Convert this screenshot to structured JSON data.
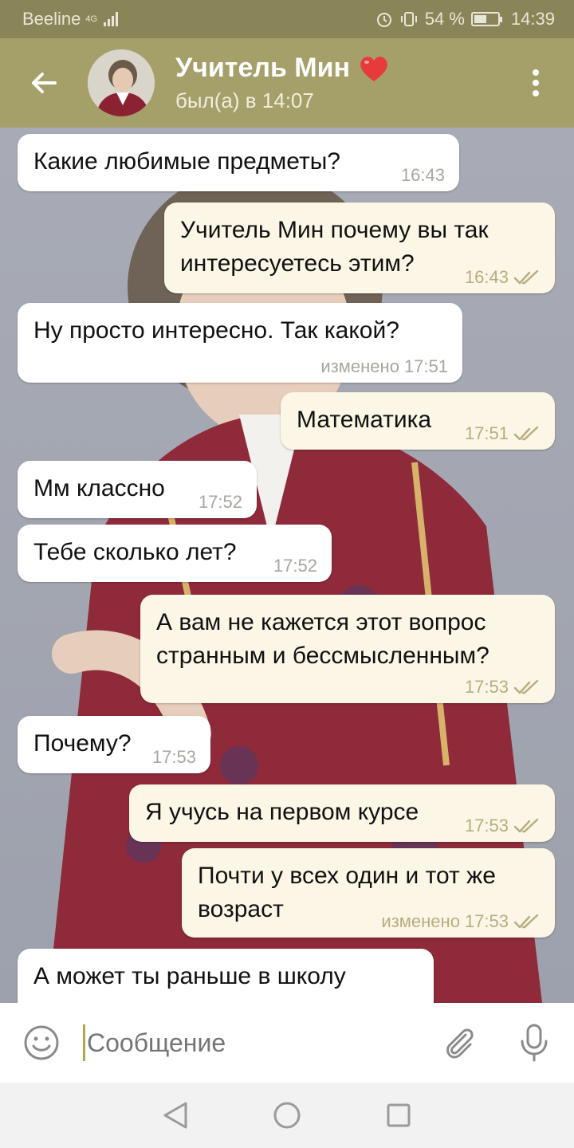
{
  "status_bar": {
    "carrier": "Beeline",
    "network": "4G",
    "battery": "54 %",
    "battery_level": 0.54,
    "time": "14:39"
  },
  "header": {
    "title": "Учитель Мин",
    "emoji": "❤️",
    "subtitle": "был(а) в 14:07",
    "back_icon": "arrow-left-icon",
    "menu_icon": "more-vert-icon"
  },
  "messages": [
    {
      "dir": "in",
      "text": "Какие любимые предметы?",
      "time": "16:43",
      "edited": ""
    },
    {
      "dir": "out",
      "text": "Учитель Мин почему вы так\nинтересуетесь этим?",
      "time": "16:43",
      "edited": ""
    },
    {
      "dir": "in",
      "text": "Ну просто интересно. Так какой?",
      "time": "17:51",
      "edited": "изменено"
    },
    {
      "dir": "out",
      "text": "Математика",
      "time": "17:51",
      "edited": ""
    },
    {
      "dir": "in",
      "text": "Мм классно",
      "time": "17:52",
      "edited": ""
    },
    {
      "dir": "in",
      "text": "Тебе сколько лет?",
      "time": "17:52",
      "edited": ""
    },
    {
      "dir": "out",
      "text": "А вам не кажется этот вопрос\nстранным и бессмысленным?",
      "time": "17:53",
      "edited": ""
    },
    {
      "dir": "in",
      "text": "Почему?",
      "time": "17:53",
      "edited": ""
    },
    {
      "dir": "out",
      "text": "Я учусь на первом курсе",
      "time": "17:53",
      "edited": ""
    },
    {
      "dir": "out",
      "text": "Почти у всех один и тот же\nвозраст",
      "time": "17:53",
      "edited": "изменено"
    },
    {
      "dir": "in",
      "text": "А может ты раньше в школу",
      "time": "",
      "edited": ""
    }
  ],
  "composer": {
    "placeholder": "Сообщение",
    "emoji_icon": "smiley-icon",
    "attach_icon": "paperclip-icon",
    "mic_icon": "microphone-icon"
  },
  "colors": {
    "header": "#a59f6a",
    "status_bar": "#8a8558",
    "bubble_in": "#ffffff",
    "bubble_out": "#fbf6e6"
  }
}
